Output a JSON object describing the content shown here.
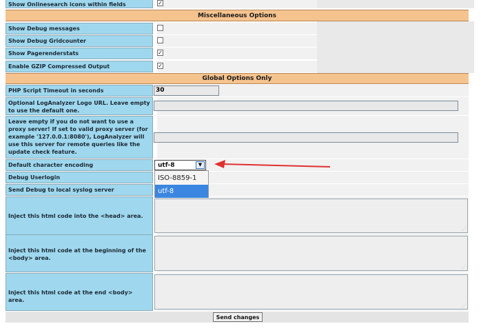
{
  "rows": {
    "onlinesearch": {
      "label": "Show Onlinesearch icons within fields",
      "checked": "✓"
    },
    "misc_header": "Miscellaneous Options",
    "debug_messages": {
      "label": "Show Debug messages",
      "checked": ""
    },
    "debug_gridcounter": {
      "label": "Show Debug Gridcounter",
      "checked": ""
    },
    "pagerenderstats": {
      "label": "Show Pagerenderstats",
      "checked": "✓"
    },
    "gzip": {
      "label": "Enable GZIP Compressed Output",
      "checked": "✓"
    },
    "global_header": "Global Options Only",
    "php_timeout": {
      "label": "PHP Script Timeout in seconds",
      "value": "30"
    },
    "logo_url": {
      "label": "Optional LogAnalyzer Logo URL. Leave empty to use the default one.",
      "value": ""
    },
    "proxy": {
      "label": "Leave empty if you do not want to use a proxy server! If set to valid proxy server (for example '127.0.0.1:8080'), LogAnalyzer will use this server for remote queries like the update check feature.",
      "value": ""
    },
    "charset": {
      "label": "Default character encoding",
      "value": "utf-8"
    },
    "debug_userlogin": {
      "label": "Debug Userlogin"
    },
    "debug_syslog": {
      "label": "Send Debug to local syslog server"
    },
    "inject_head": {
      "label": "Inject this html code into the <head> area."
    },
    "inject_body_begin": {
      "label": "Inject this html code at the beginning of the <body> area."
    },
    "inject_body_end": {
      "label": "Inject this html code at the end <body> area."
    }
  },
  "dropdown": {
    "options": [
      "ISO-8859-1",
      "utf-8"
    ],
    "selected": "utf-8"
  },
  "actions": {
    "submit": "Send changes"
  },
  "colors": {
    "label_bg": "#9fd8ee",
    "header_bg": "#f5c38e",
    "arrow": "#e03030",
    "selected": "#3b86e0"
  }
}
